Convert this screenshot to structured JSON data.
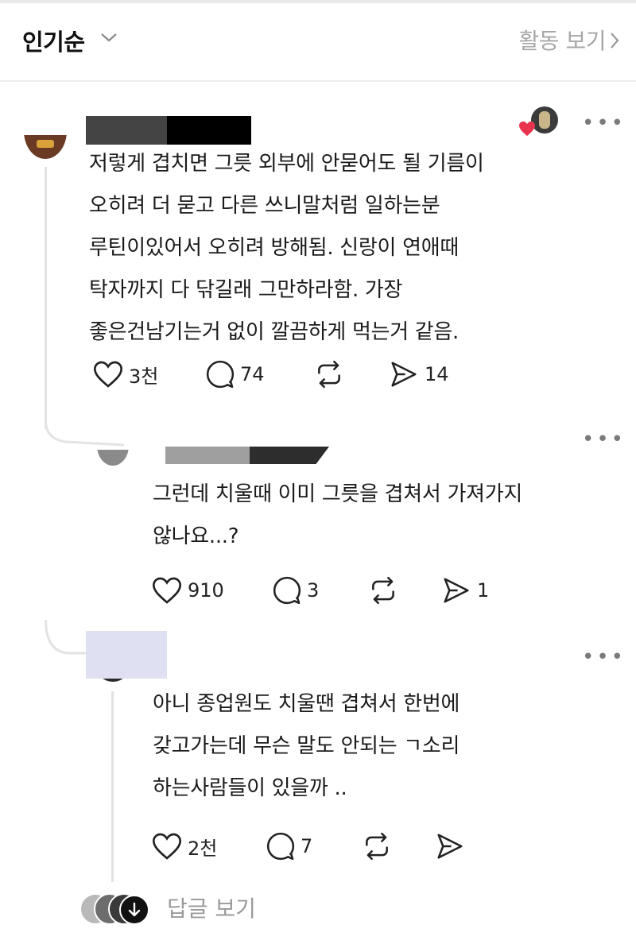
{
  "header": {
    "title": "인기순",
    "activity_label": "활동 보기"
  },
  "comments": [
    {
      "lines": [
        "저렇게 겹치면 그릇 외부에 안묻어도 될 기름이",
        "오히려 더 묻고 다른 쓰니말처럼 일하는분",
        "루틴이있어서 오히려 방해됨. 신랑이 연애때",
        "탁자까지 다 닦길래 그만하라함. 가장",
        "좋은건남기는거 없이 깔끔하게 먹는거 같음."
      ],
      "likes": "3천",
      "comments": "74",
      "shares": "14"
    },
    {
      "lines": [
        "그런데 치울때 이미 그릇을 겹쳐서 가져가지",
        "않나요...?"
      ],
      "likes": "910",
      "comments": "3",
      "shares": "1"
    },
    {
      "lines": [
        "아니 종업원도 치울땐 겹쳐서 한번에",
        "갖고가는데 무슨 말도 안되는 ㄱ소리",
        "하는사람들이 있을까 .."
      ],
      "likes": "2천",
      "comments": "7"
    }
  ],
  "footer": {
    "more_replies_label": "답글 보기"
  },
  "icons": {
    "like": "heart-icon",
    "comment": "comment-bubble-icon",
    "repost": "repost-icon",
    "share": "send-icon",
    "more": "more-dots-icon"
  },
  "colors": {
    "text": "#1a1a1a",
    "muted": "#a6a6a6",
    "heart_badge": "#e8344e"
  }
}
